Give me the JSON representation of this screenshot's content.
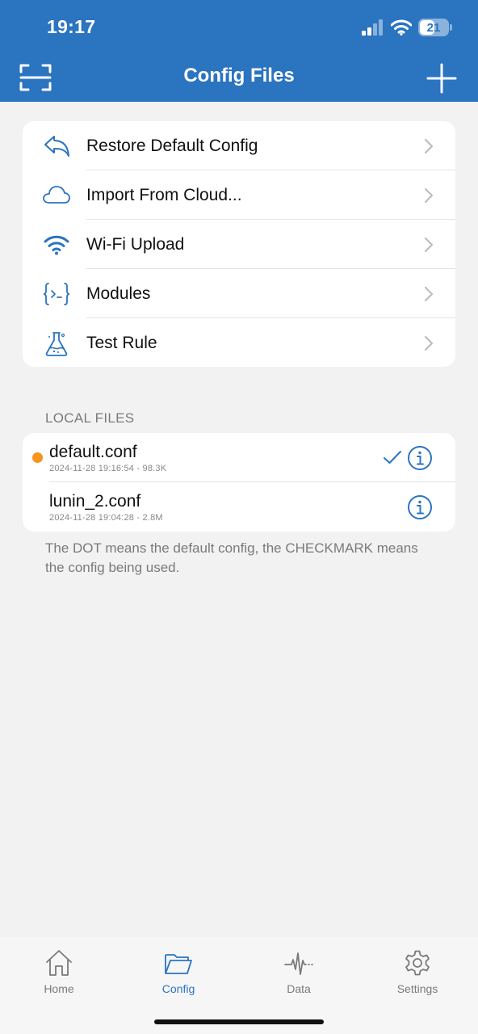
{
  "status_bar": {
    "time": "19:17",
    "battery": "21"
  },
  "header": {
    "title": "Config Files"
  },
  "menu": [
    {
      "label": "Restore Default Config",
      "icon": "undo-arrow-icon"
    },
    {
      "label": "Import From Cloud...",
      "icon": "cloud-icon"
    },
    {
      "label": "Wi-Fi Upload",
      "icon": "wifi-icon"
    },
    {
      "label": "Modules",
      "icon": "code-braces-icon"
    },
    {
      "label": "Test Rule",
      "icon": "flask-icon"
    }
  ],
  "local_files": {
    "section_title": "LOCAL FILES",
    "files": [
      {
        "name": "default.conf",
        "meta": "2024-11-28 19:16:54 - 98.3K",
        "is_default": true,
        "in_use": true
      },
      {
        "name": "lunin_2.conf",
        "meta": "2024-11-28 19:04:28 - 2.8M",
        "is_default": false,
        "in_use": false
      }
    ],
    "footnote": "The DOT means the default config, the CHECKMARK means the config being used."
  },
  "tabbar": {
    "tabs": [
      {
        "label": "Home",
        "icon": "home-icon",
        "active": false
      },
      {
        "label": "Config",
        "icon": "folder-icon",
        "active": true
      },
      {
        "label": "Data",
        "icon": "pulse-icon",
        "active": false
      },
      {
        "label": "Settings",
        "icon": "gear-icon",
        "active": false
      }
    ]
  },
  "colors": {
    "accent": "#2b74c0",
    "default_dot": "#f7941d",
    "background": "#f2f2f2"
  }
}
